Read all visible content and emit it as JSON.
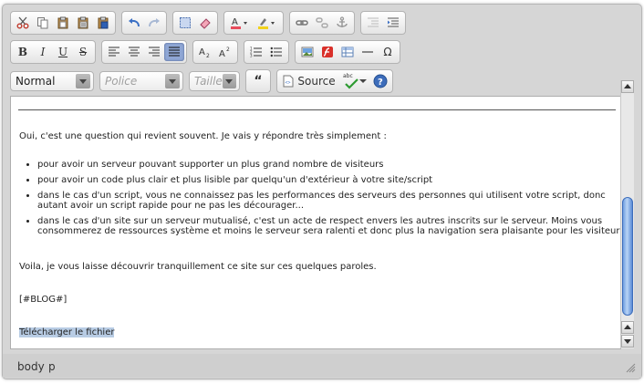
{
  "toolbar": {
    "format": {
      "value": "Normal"
    },
    "font": {
      "placeholder": "Police"
    },
    "size": {
      "placeholder": "Taille"
    },
    "blockquote_label": "“",
    "source_label": "Source",
    "spell_label": "abc"
  },
  "content": {
    "intro": "Oui, c'est une question qui revient souvent. Je vais y répondre très simplement :",
    "items": [
      "pour avoir un serveur pouvant supporter un plus grand nombre de visiteurs",
      "pour avoir un code plus clair et plus lisible par quelqu'un d'extérieur à votre site/script",
      "dans le cas d'un script, vous ne connaissez pas les performances des serveurs des personnes qui utilisent votre script, donc autant avoir un script rapide pour ne pas les décourager...",
      "dans le cas d'un site sur un serveur mutualisé, c'est un acte de respect envers les autres inscrits sur le serveur. Moins vous consommerez de ressources système et moins le serveur sera ralenti et donc plus la navigation sera plaisante pour les visiteurs"
    ],
    "outro": "Voila, je vous laisse découvrir tranquillement ce site sur ces quelques paroles.",
    "tag": "[#BLOG#]",
    "download_link": "Télécharger le fichier"
  },
  "statusbar": {
    "path": [
      "body",
      "p"
    ]
  },
  "colors": {
    "active_button": "#8fa6d4",
    "selection": "#b8cce4",
    "scroll_thumb": "#6e9de0",
    "help_icon": "#3d6dbb"
  },
  "scroll": {
    "position_fraction": 0.55
  }
}
